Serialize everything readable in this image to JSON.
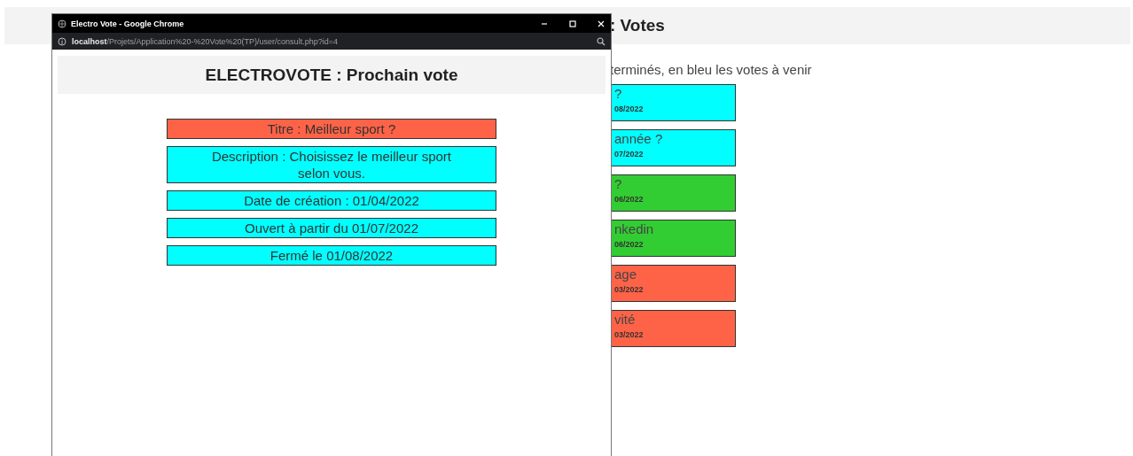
{
  "background_page": {
    "header_title": ": Votes",
    "legend": "terminés, en bleu les votes à venir",
    "votes": [
      {
        "title": "?",
        "date": "08/2022",
        "color": "#00ffff"
      },
      {
        "title": "année ?",
        "date": "07/2022",
        "color": "#00ffff"
      },
      {
        "title": "?",
        "date": "06/2022",
        "color": "#32cd32"
      },
      {
        "title": "nkedin",
        "date": "06/2022",
        "color": "#32cd32"
      },
      {
        "title": "age",
        "date": "03/2022",
        "color": "#ff6347"
      },
      {
        "title": "vité",
        "date": "03/2022",
        "color": "#ff6347"
      }
    ]
  },
  "popup": {
    "window_title": "Electro Vote - Google Chrome",
    "url_host": "localhost",
    "url_path": "/Projets/Application%20-%20Vote%20(TP)/user/consult.php?id=4",
    "heading": "ELECTROVOTE : Prochain vote",
    "fields": [
      {
        "text": "Titre : Meilleur sport ?",
        "color": "#ff6347"
      },
      {
        "text": "Description : Choisissez le meilleur sport selon vous.",
        "color": "#00ffff"
      },
      {
        "text": "Date de création : 01/04/2022",
        "color": "#00ffff"
      },
      {
        "text": "Ouvert à partir du 01/07/2022",
        "color": "#00ffff"
      },
      {
        "text": "Fermé le 01/08/2022",
        "color": "#00ffff"
      }
    ]
  }
}
